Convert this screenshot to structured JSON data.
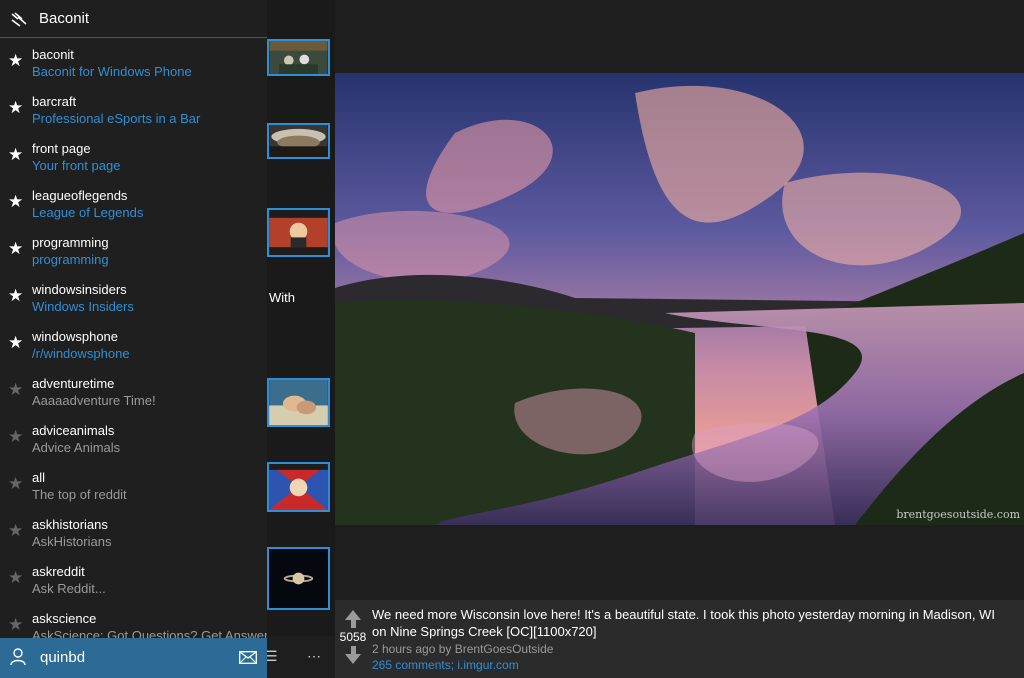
{
  "app": {
    "title": "Baconit"
  },
  "subreddits": [
    {
      "name": "baconit",
      "desc": "Baconit for Windows Phone",
      "favorite": true
    },
    {
      "name": "barcraft",
      "desc": "Professional eSports in a Bar",
      "favorite": true
    },
    {
      "name": "front page",
      "desc": "Your front page",
      "favorite": true
    },
    {
      "name": "leagueoflegends",
      "desc": "League of Legends",
      "favorite": true
    },
    {
      "name": "programming",
      "desc": "programming",
      "favorite": true
    },
    {
      "name": "windowsinsiders",
      "desc": "Windows Insiders",
      "favorite": true
    },
    {
      "name": "windowsphone",
      "desc": "/r/windowsphone",
      "favorite": true
    },
    {
      "name": "adventuretime",
      "desc": "Aaaaadventure Time!",
      "favorite": false
    },
    {
      "name": "adviceanimals",
      "desc": "Advice Animals",
      "favorite": false
    },
    {
      "name": "all",
      "desc": "The top of reddit",
      "favorite": false
    },
    {
      "name": "askhistorians",
      "desc": "AskHistorians",
      "favorite": false
    },
    {
      "name": "askreddit",
      "desc": "Ask Reddit...",
      "favorite": false
    },
    {
      "name": "askscience",
      "desc": "AskScience: Got Questions? Get Answers.",
      "favorite": false
    }
  ],
  "user": {
    "name": "quinbd"
  },
  "postlist": {
    "partial_text": "With"
  },
  "post": {
    "score": "5058",
    "title": "We need more Wisconsin love here! It's a beautiful state. I took this photo yesterday morning in Madison, WI on Nine Springs Creek [OC][1100x720]",
    "meta": "2 hours ago by BrentGoesOutside",
    "link": "265 comments; i.imgur.com",
    "watermark": "brentgoesoutside.com"
  },
  "colors": {
    "accent": "#2f8fd6",
    "userbar": "#2b6b96"
  }
}
